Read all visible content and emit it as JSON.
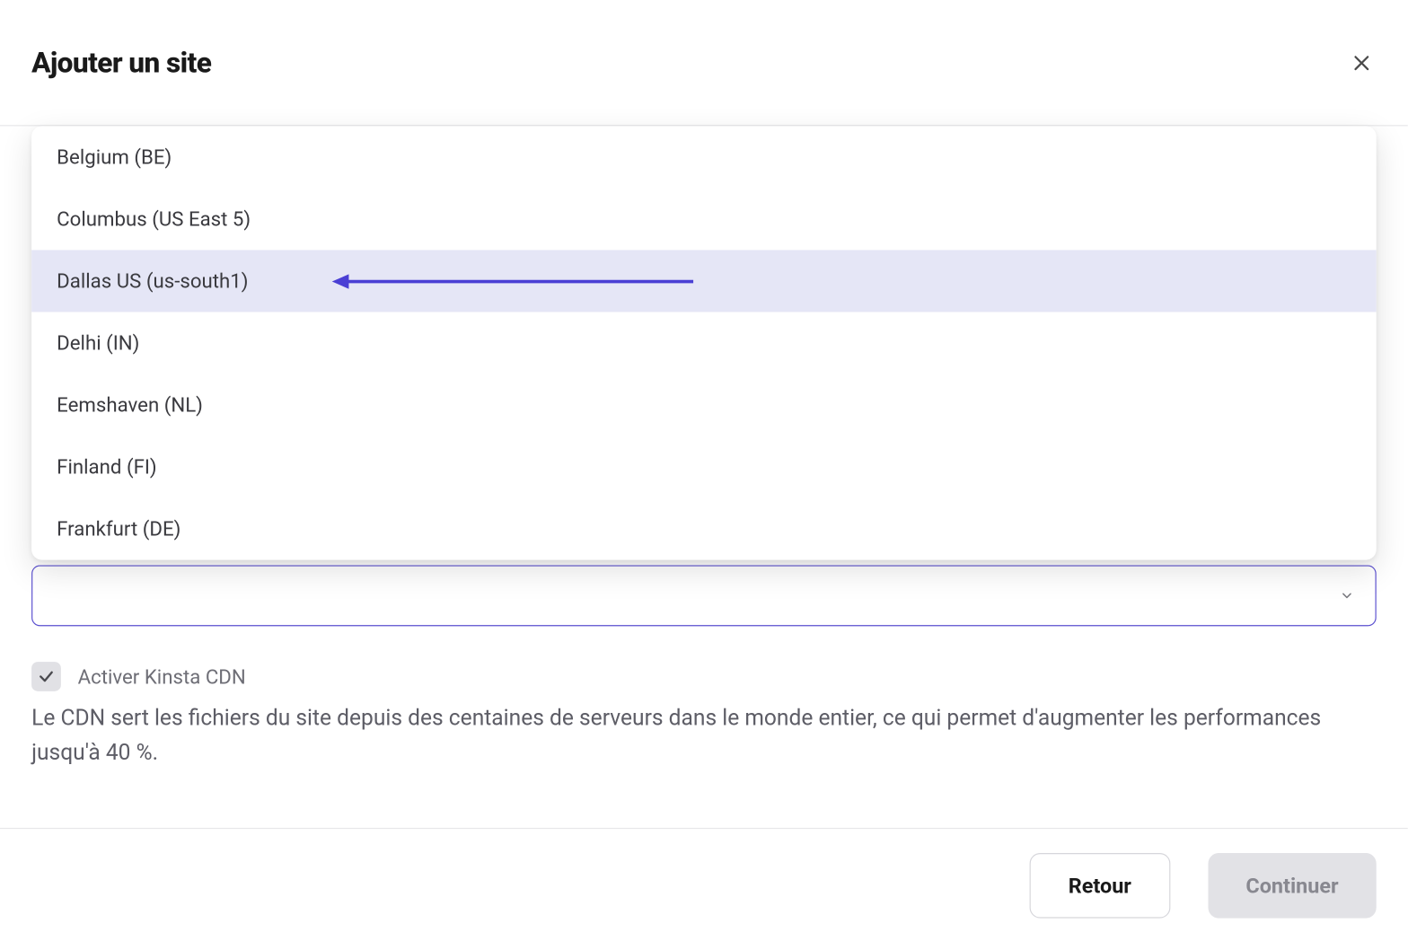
{
  "header": {
    "title": "Ajouter un site"
  },
  "dropdown": {
    "items": [
      {
        "label": "Belgium (BE)",
        "highlighted": false
      },
      {
        "label": "Columbus (US East 5)",
        "highlighted": false
      },
      {
        "label": "Dallas US (us-south1)",
        "highlighted": true
      },
      {
        "label": "Delhi (IN)",
        "highlighted": false
      },
      {
        "label": "Eemshaven (NL)",
        "highlighted": false
      },
      {
        "label": "Finland (FI)",
        "highlighted": false
      },
      {
        "label": "Frankfurt (DE)",
        "highlighted": false
      }
    ]
  },
  "cdn": {
    "checkbox_checked": true,
    "label": "Activer Kinsta CDN",
    "description": "Le CDN sert les fichiers du site depuis des centaines de serveurs dans le monde entier, ce qui permet d'augmenter les performances jusqu'à 40 %."
  },
  "footer": {
    "back_label": "Retour",
    "continue_label": "Continuer"
  }
}
